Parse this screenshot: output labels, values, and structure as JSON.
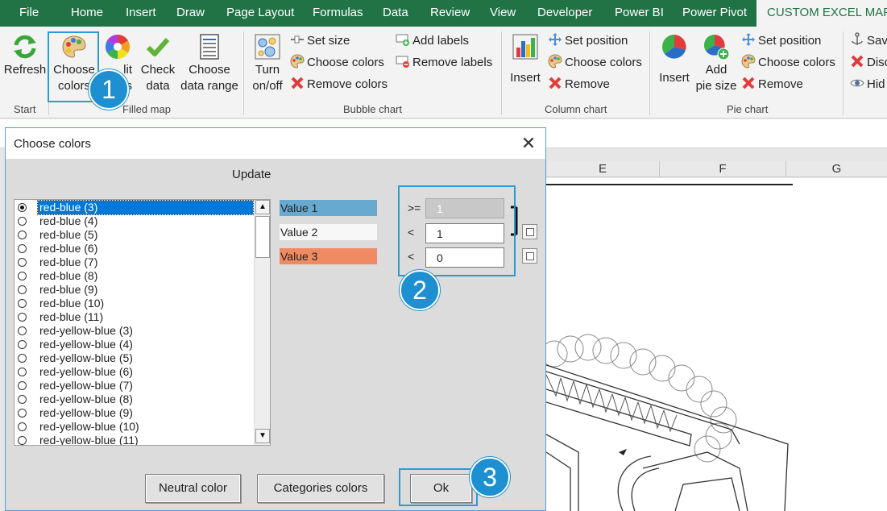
{
  "tabs": [
    "File",
    "Home",
    "Insert",
    "Draw",
    "Page Layout",
    "Formulas",
    "Data",
    "Review",
    "View",
    "Developer",
    "Power BI",
    "Power Pivot",
    "CUSTOM EXCEL MAP"
  ],
  "ribbon": {
    "start": {
      "refresh": "Refresh",
      "group": "Start"
    },
    "filled_map": {
      "choose_colors": [
        "Choose",
        "colors"
      ],
      "edit_partial": [
        "lit",
        "s"
      ],
      "check_data": [
        "Check",
        "data"
      ],
      "choose_data_range": [
        "Choose",
        "data range"
      ],
      "group": "Filled map"
    },
    "bubble": {
      "turn_onoff": [
        "Turn",
        "on/off"
      ],
      "set_size": "Set size",
      "choose_colors": "Choose colors",
      "remove_colors": "Remove colors",
      "add_labels": "Add labels",
      "remove_labels": "Remove labels",
      "group": "Bubble chart"
    },
    "column": {
      "insert": "Insert",
      "set_position": "Set position",
      "choose_colors": "Choose colors",
      "remove": "Remove",
      "group": "Column chart"
    },
    "pie": {
      "insert": "Insert",
      "add_pie_size": [
        "Add",
        "pie size"
      ],
      "set_position": "Set position",
      "choose_colors": "Choose colors",
      "remove": "Remove",
      "group": "Pie chart"
    },
    "extra": {
      "save": "Sav",
      "disc": "Disc",
      "hid": "Hid"
    }
  },
  "sheet": {
    "columns": [
      "E",
      "F",
      "G"
    ]
  },
  "dialog": {
    "title": "Choose colors",
    "close": "✕",
    "update": "Update",
    "schemes": [
      "red-blue (3)",
      "red-blue (4)",
      "red-blue (5)",
      "red-blue (6)",
      "red-blue (7)",
      "red-blue (8)",
      "red-blue (9)",
      "red-blue (10)",
      "red-blue (11)",
      "red-yellow-blue (3)",
      "red-yellow-blue (4)",
      "red-yellow-blue (5)",
      "red-yellow-blue (6)",
      "red-yellow-blue (7)",
      "red-yellow-blue (8)",
      "red-yellow-blue (9)",
      "red-yellow-blue (10)",
      "red-yellow-blue (11)"
    ],
    "selected_index": 0,
    "values": [
      {
        "label": "Value 1",
        "color": "#67a9cf"
      },
      {
        "label": "Value 2",
        "color": "#f7f7f7"
      },
      {
        "label": "Value 3",
        "color": "#ef8a62"
      }
    ],
    "thresholds": [
      {
        "op": ">=",
        "value": "1",
        "disabled": true
      },
      {
        "op": "<",
        "value": "1",
        "disabled": false
      },
      {
        "op": "<",
        "value": "0",
        "disabled": false
      }
    ],
    "buttons": {
      "neutral": "Neutral color",
      "categories": "Categories colors",
      "ok": "Ok"
    }
  },
  "badges": [
    "1",
    "2",
    "3"
  ],
  "colors": {
    "excel_green": "#217346",
    "highlight": "#2b9bd8",
    "badge": "#1e8fd0"
  }
}
